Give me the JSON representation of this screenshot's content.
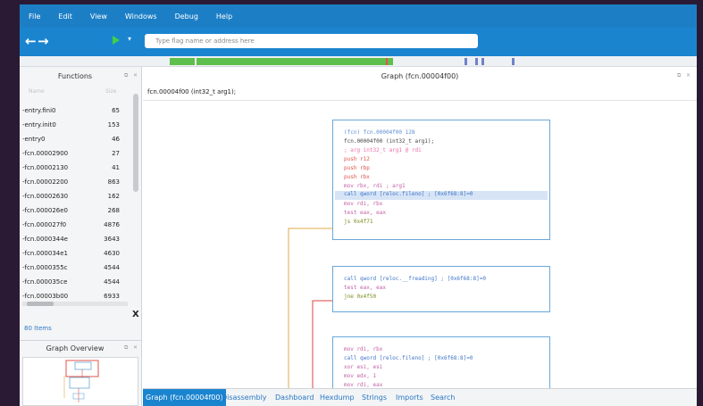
{
  "menu": [
    "File",
    "Edit",
    "View",
    "Windows",
    "Debug",
    "Help"
  ],
  "toolbar": {
    "back_icon": "arrow-left-icon",
    "forward_icon": "arrow-right-icon",
    "play_icon": "play-icon",
    "dropdown_icon": "chevron-down-icon",
    "search_placeholder": "Type flag name or address here"
  },
  "functions_panel": {
    "title": "Functions",
    "columns": [
      "Name",
      "Size"
    ],
    "rows": [
      {
        "name": "-entry.fini0",
        "size": "65"
      },
      {
        "name": "-entry.init0",
        "size": "153"
      },
      {
        "name": "-entry0",
        "size": "46"
      },
      {
        "name": "-fcn.00002900",
        "size": "27"
      },
      {
        "name": "-fcn.00002130",
        "size": "41"
      },
      {
        "name": "-fcn.00002200",
        "size": "863"
      },
      {
        "name": "-fcn.00002630",
        "size": "162"
      },
      {
        "name": "-fcn.000026e0",
        "size": "268"
      },
      {
        "name": "-fcn.000027f0",
        "size": "4876"
      },
      {
        "name": "-fcn.0000344e",
        "size": "3643"
      },
      {
        "name": "-fcn.000034e1",
        "size": "4630"
      },
      {
        "name": "-fcn.0000355c",
        "size": "4544"
      },
      {
        "name": "-fcn.000035ce",
        "size": "4544"
      },
      {
        "name": "-fcn.00003b00",
        "size": "6933"
      }
    ],
    "close_label": "X",
    "items_count": "80 Items"
  },
  "graph_overview": {
    "title": "Graph Overview"
  },
  "graph_panel": {
    "title": "Graph (fcn.00004f00)",
    "function_label": "fcn.00004f00 (int32_t arg1);",
    "blocks": [
      {
        "lines": [
          {
            "text": "(fcn) fcn.00004f00 128",
            "kind": "hdr"
          },
          {
            "text": "  fcn.00004f00 (int32_t arg1);",
            "kind": "op"
          },
          {
            "text": "; arg int32_t arg1 @ rdi",
            "kind": "cm"
          },
          {
            "text": "push r12",
            "kind": "kw"
          },
          {
            "text": "push rbp",
            "kind": "kw"
          },
          {
            "text": "push rbx",
            "kind": "kw"
          },
          {
            "text": "mov  rbx, rdi                 ; arg1",
            "kind": "ar"
          },
          {
            "text": "call qword [reloc.fileno]     ; [0x6f68:8]=0",
            "kind": "cl",
            "highlight": true
          },
          {
            "text": "mov  rdi, rbx",
            "kind": "ar"
          },
          {
            "text": "test eax, eax",
            "kind": "ar"
          },
          {
            "text": "js   0x4f71",
            "kind": "jp"
          }
        ]
      },
      {
        "lines": [
          {
            "text": "call qword [reloc.__freading]     ; [0x6f68:8]=0",
            "kind": "cl"
          },
          {
            "text": "test eax, eax",
            "kind": "ar"
          },
          {
            "text": "jne  0x4f50",
            "kind": "jp"
          }
        ]
      },
      {
        "lines": [
          {
            "text": "mov  rdi, rbx",
            "kind": "ar"
          },
          {
            "text": "call qword [reloc.fileno]     ; [0x6f68:8]=0",
            "kind": "cl"
          },
          {
            "text": "xor  esi, esi",
            "kind": "ar"
          },
          {
            "text": "mov  edx, 1",
            "kind": "ar"
          },
          {
            "text": "mov  rdi, eax",
            "kind": "ar"
          }
        ]
      }
    ]
  },
  "tabs": [
    "Graph (fcn.00004f00)",
    "Disassembly",
    "Dashboard",
    "Hexdump",
    "Strings",
    "Imports",
    "Search"
  ],
  "colors": {
    "accent": "#1a84cf",
    "strip_green": "#5fbf4c",
    "true_edge": "#7a9a1e",
    "false_edge": "#e0534a",
    "jump_edge": "#e0a84a"
  }
}
